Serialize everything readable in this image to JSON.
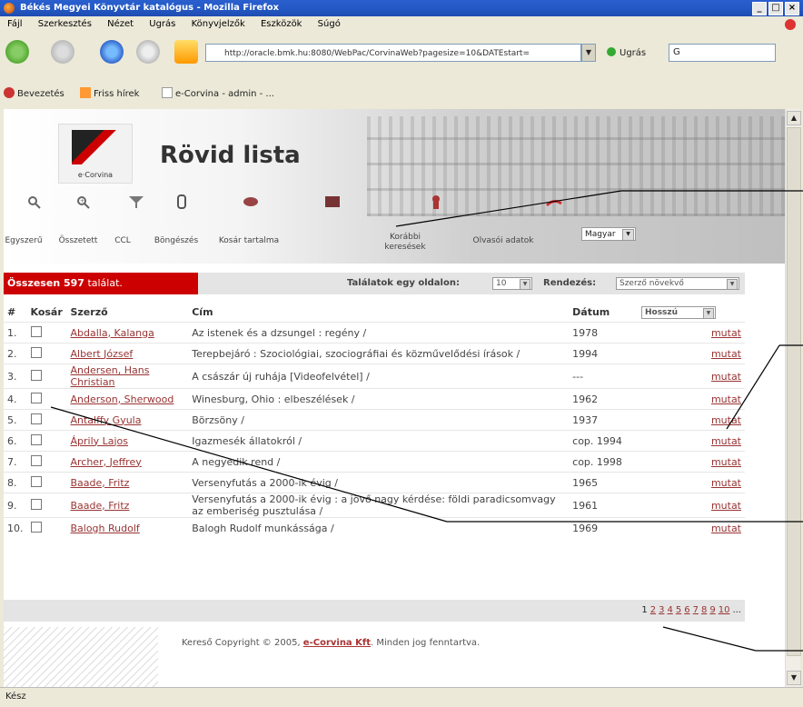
{
  "window": {
    "title": "Békés Megyei Könyvtár katalógus - Mozilla Firefox",
    "controls": [
      "_",
      "□",
      "×"
    ]
  },
  "menu": [
    "Fájl",
    "Szerkesztés",
    "Nézet",
    "Ugrás",
    "Könyvjelzők",
    "Eszközök",
    "Súgó"
  ],
  "toolbar": {
    "url": "http://oracle.bmk.hu:8080/WebPac/CorvinaWeb?pagesize=10&DATEstart=",
    "go_label": "Ugrás",
    "search_placeholder": "G"
  },
  "bookmarks": [
    "Bevezetés",
    "Friss hírek",
    "e-Corvina - admin - ..."
  ],
  "page": {
    "logo_text": "e·Corvina",
    "title": "Rövid lista",
    "nav": [
      "Egyszerű",
      "Összetett",
      "CCL",
      "Böngészés",
      "Kosár tartalma",
      "Korábbi\nkeresések",
      "Olvasói adatok"
    ],
    "language": "Magyar"
  },
  "results": {
    "count_prefix": "Összesen ",
    "count": "597",
    "count_suffix": " találat.",
    "per_page_label": "Találatok egy oldalon:",
    "per_page_value": "10",
    "sort_label": "Rendezés:",
    "sort_value": "Szerző növekvő",
    "view_value": "Hosszú",
    "headers": {
      "num": "#",
      "cart": "Kosár",
      "author": "Szerző",
      "title": "Cím",
      "date": "Dátum"
    },
    "show_label": "mutat",
    "rows": [
      {
        "n": "1.",
        "author": "Abdalla, Kalanga",
        "title": "Az istenek és a dzsungel : regény /",
        "date": "1978"
      },
      {
        "n": "2.",
        "author": "Albert József",
        "title": "Terepbejáró : Szociológiai, szociográfiai és közművelődési írások /",
        "date": "1994"
      },
      {
        "n": "3.",
        "author": "Andersen, Hans Christian",
        "title": "A császár új ruhája [Videofelvétel] /",
        "date": "---"
      },
      {
        "n": "4.",
        "author": "Anderson, Sherwood",
        "title": "Winesburg, Ohio : elbeszélések /",
        "date": "1962"
      },
      {
        "n": "5.",
        "author": "Antalffy Gyula",
        "title": "Börzsöny /",
        "date": "1937"
      },
      {
        "n": "6.",
        "author": "Áprily Lajos",
        "title": "Igazmesék állatokról /",
        "date": "cop. 1994"
      },
      {
        "n": "7.",
        "author": "Archer, Jeffrey",
        "title": "A negyedik rend /",
        "date": "cop. 1998"
      },
      {
        "n": "8.",
        "author": "Baade, Fritz",
        "title": "Versenyfutás a 2000-ik évig /",
        "date": "1965"
      },
      {
        "n": "9.",
        "author": "Baade, Fritz",
        "title": "Versenyfutás a 2000-ik évig : a jövő nagy kérdése: földi paradicsomvagy az emberiség pusztulása /",
        "date": "1961"
      },
      {
        "n": "10.",
        "author": "Balogh Rudolf",
        "title": "Balogh Rudolf munkássága /",
        "date": "1969"
      }
    ],
    "pages": [
      "1",
      "2",
      "3",
      "4",
      "5",
      "6",
      "7",
      "8",
      "9",
      "10",
      "..."
    ]
  },
  "footer": {
    "before": "Kereső Copyright © 2005, ",
    "company": "e-Corvina Kft",
    "after": ". Minden jog fenntartva."
  },
  "status": "Kész"
}
